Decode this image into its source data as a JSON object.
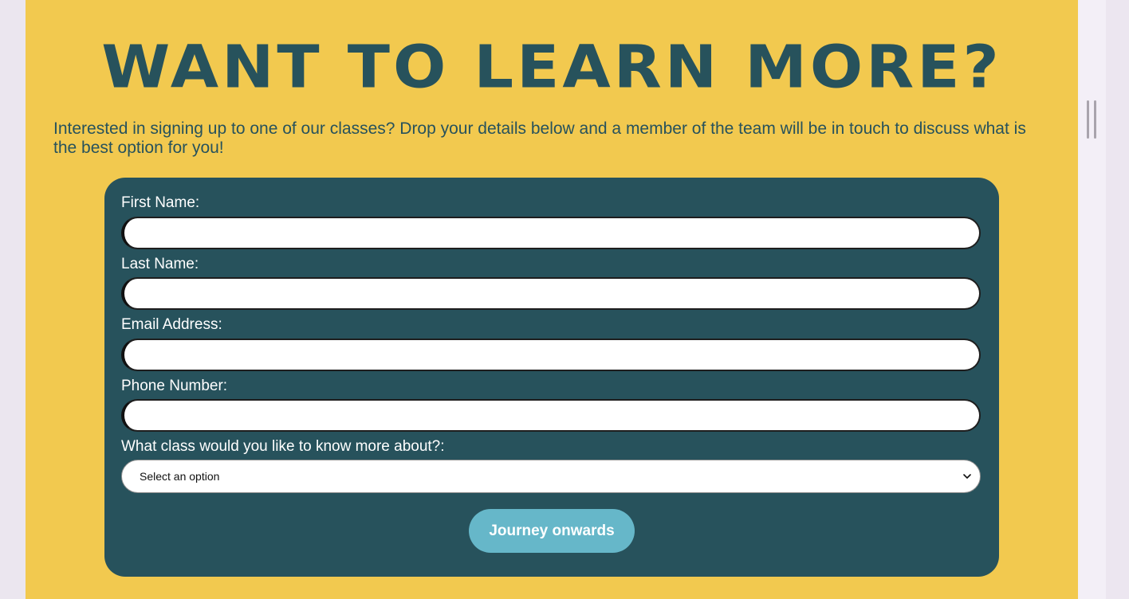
{
  "page": {
    "title": "WANT TO LEARN MORE?",
    "intro": "Interested in signing up to one of our classes? Drop your details below and a member of the team will be in touch to discuss what is the best option for you!"
  },
  "form": {
    "fields": [
      {
        "label": "First Name:",
        "value": "",
        "placeholder": ""
      },
      {
        "label": "Last Name:",
        "value": "",
        "placeholder": ""
      },
      {
        "label": "Email Address:",
        "value": "",
        "placeholder": ""
      },
      {
        "label": "Phone Number:",
        "value": "",
        "placeholder": ""
      }
    ],
    "class_select": {
      "label": "What class would you like to know more about?:",
      "selected": "Select an option"
    },
    "submit_label": "Journey onwards"
  },
  "icons": {
    "select_toggle": "chevron-down-icon",
    "scrollbar": "scrollbar-thumb"
  },
  "colors": {
    "panel_background": "#f2c94f",
    "brand_teal": "#27525c",
    "button_accent": "#66b7c9",
    "page_background": "#ece6f0"
  }
}
